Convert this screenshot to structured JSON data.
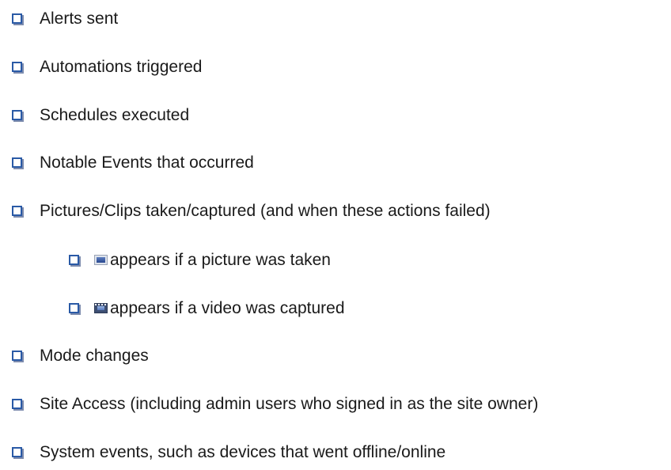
{
  "items": [
    {
      "label": "Alerts sent"
    },
    {
      "label": "Automations triggered"
    },
    {
      "label": "Schedules executed"
    },
    {
      "label": "Notable Events that occurred"
    },
    {
      "label": "Pictures/Clips taken/captured (and when these actions failed)"
    },
    {
      "label": "appears if a picture was taken",
      "icon": "picture-icon"
    },
    {
      "label": "appears if a video was captured",
      "icon": "video-clip-icon"
    },
    {
      "label": "Mode changes"
    },
    {
      "label": "Site Access (including admin users who signed in as the site owner)"
    },
    {
      "label": "System events, such as devices that went offline/online"
    }
  ],
  "colors": {
    "bullet_border": "#2a5aa6",
    "bullet_shadow": "#7d8cae",
    "text": "#1a1a1a"
  }
}
